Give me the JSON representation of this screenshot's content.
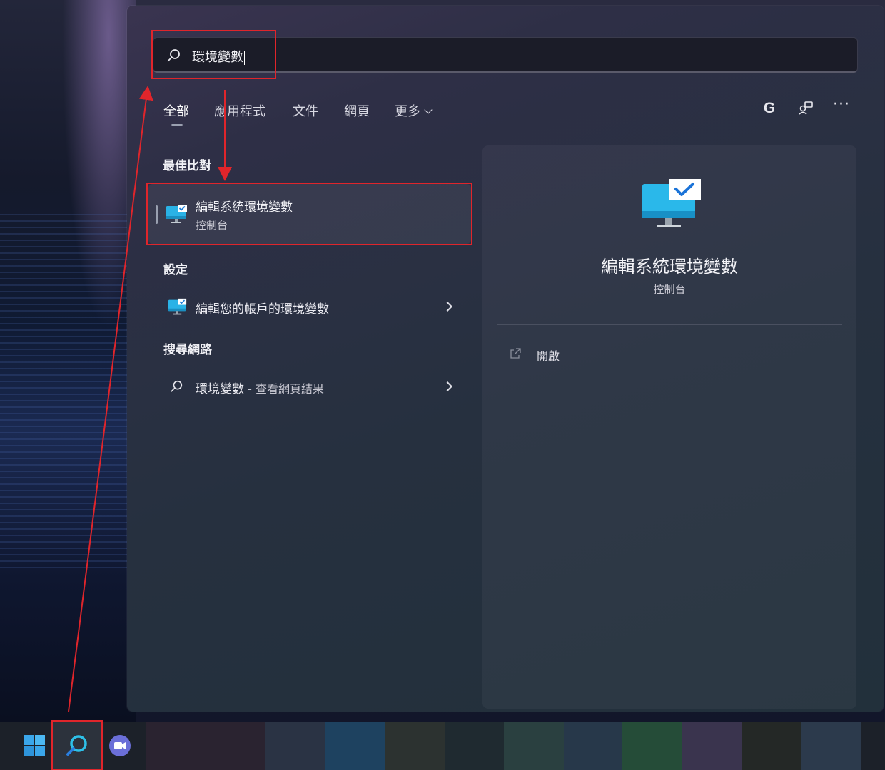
{
  "search": {
    "query": "環境變數",
    "icon": "search-icon"
  },
  "tabs": [
    {
      "label": "全部",
      "active": true
    },
    {
      "label": "應用程式",
      "active": false
    },
    {
      "label": "文件",
      "active": false
    },
    {
      "label": "網頁",
      "active": false
    },
    {
      "label": "更多",
      "active": false,
      "has_dropdown": true
    }
  ],
  "toolbar": {
    "account_letter": "G",
    "more_label": "···",
    "icons": [
      "google-account-icon",
      "share-devices-icon",
      "more-options-icon"
    ]
  },
  "sections": {
    "best_match": {
      "title": "最佳比對",
      "result_title": "編輯系統環境變數",
      "result_sub": "控制台",
      "icon": "system-settings-monitor-icon"
    },
    "settings": {
      "title": "設定",
      "item_label": "編輯您的帳戶的環境變數",
      "icon": "system-settings-monitor-icon"
    },
    "web": {
      "title": "搜尋網路",
      "item_query": "環境變數",
      "item_suffix": " - 查看網頁結果",
      "icon": "search-icon"
    }
  },
  "preview": {
    "title": "編輯系統環境變數",
    "sub": "控制台",
    "action_label": "開啟",
    "action_icon": "open-external-icon"
  },
  "taskbar": {
    "items": [
      "windows-start-icon",
      "search-icon",
      "teams-chat-icon"
    ]
  },
  "colors": {
    "annotation_red": "#e0252b",
    "accent_blue": "#1f9fd8"
  }
}
